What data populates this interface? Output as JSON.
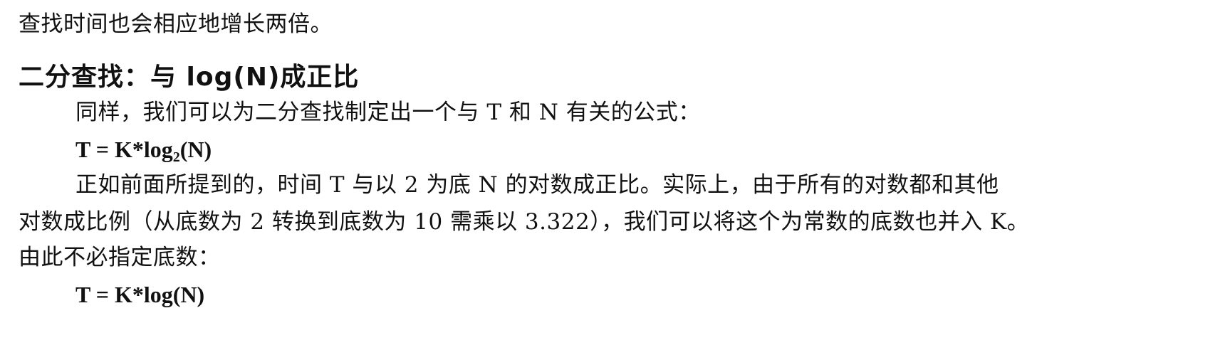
{
  "lines": {
    "intro": "查找时间也会相应地增长两倍。",
    "heading": "二分查找：与 log(N)成正比",
    "p1": "同样，我们可以为二分查找制定出一个与 T 和 N 有关的公式：",
    "formula1": {
      "prefix": "T = K*log",
      "subscript": "2",
      "suffix": "(N)"
    },
    "p2_line1": "正如前面所提到的，时间 T 与以 2 为底 N 的对数成正比。实际上，由于所有的对数都和其他",
    "p2_line2": "对数成比例（从底数为 2 转换到底数为 10 需乘以 3.322），我们可以将这个为常数的底数也并入 K。",
    "p2_line3": "由此不必指定底数：",
    "formula2": "T = K*log(N)"
  }
}
